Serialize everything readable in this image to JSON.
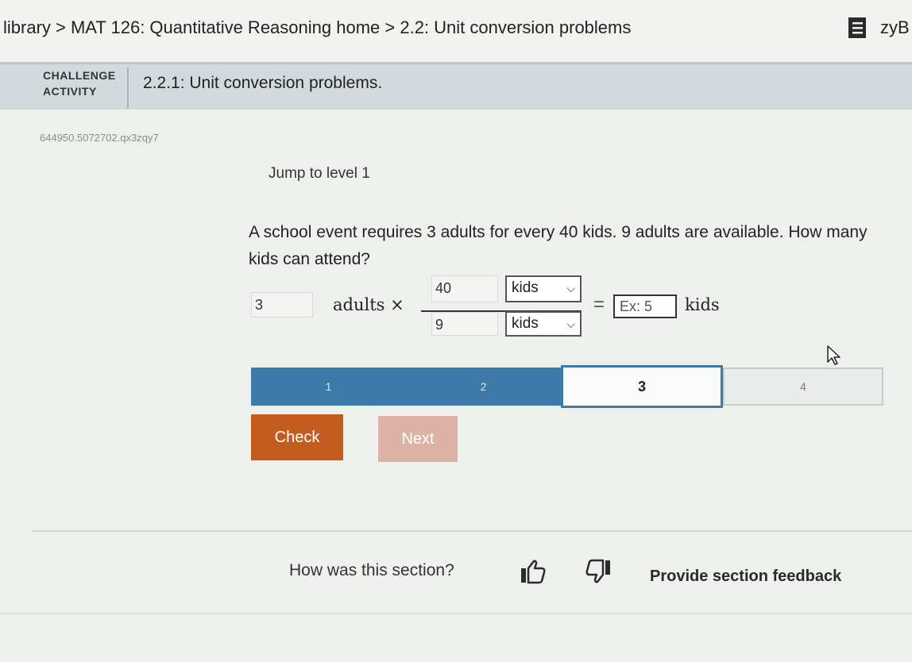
{
  "topbar": {
    "breadcrumb": "library > MAT 126: Quantitative Reasoning home > 2.2: Unit conversion problems",
    "brand": "zyB",
    "book_icon": "book-icon"
  },
  "activity": {
    "type_line1": "CHALLENGE",
    "type_line2": "ACTIVITY",
    "title": "2.2.1: Unit conversion problems.",
    "id": "644950.5072702.qx3zqy7",
    "jump_label": "Jump to level 1"
  },
  "question": {
    "text": "A school event requires 3 adults for every 40 kids. 9 adults are available. How many kids can attend?"
  },
  "equation": {
    "given_value": "3",
    "given_unit": "adults",
    "times": "×",
    "numerator_value": "40",
    "numerator_unit": "kids",
    "denominator_value": "9",
    "denominator_unit": "kids",
    "equals": "=",
    "answer_placeholder": "Ex: 5",
    "result_unit": "kids"
  },
  "levels": {
    "items": [
      {
        "label": "1",
        "state": "done"
      },
      {
        "label": "2",
        "state": "done"
      },
      {
        "label": "3",
        "state": "current"
      },
      {
        "label": "4",
        "state": "todo"
      }
    ]
  },
  "buttons": {
    "check": "Check",
    "next": "Next"
  },
  "feedback": {
    "question": "How was this section?",
    "link": "Provide section feedback"
  },
  "colors": {
    "accent": "#c45c20",
    "level_blue": "#3d7aa8",
    "header_bg": "#d3dade"
  }
}
